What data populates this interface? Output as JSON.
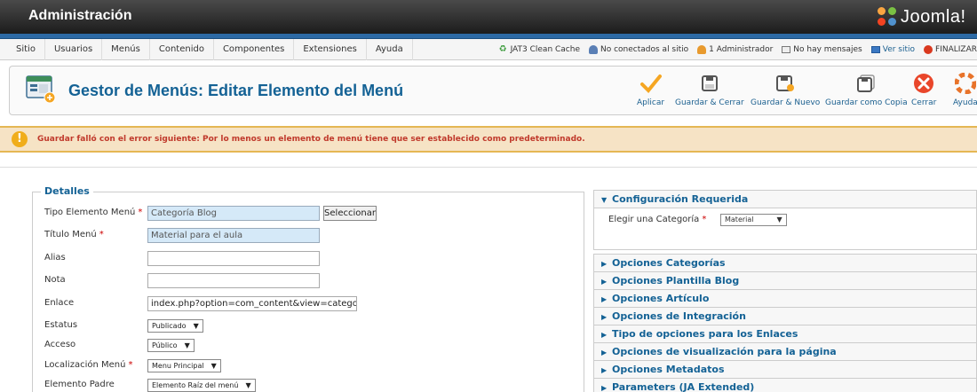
{
  "header": {
    "title": "Administración",
    "logo_text": "Joomla!"
  },
  "menubar": {
    "items": [
      "Sitio",
      "Usuarios",
      "Menús",
      "Contenido",
      "Componentes",
      "Extensiones",
      "Ayuda"
    ],
    "status": [
      "JAT3 Clean Cache",
      "No conectados al sitio",
      "1 Administrador",
      "No hay mensajes",
      "Ver sitio",
      "FINALIZAR"
    ]
  },
  "toolbar": {
    "title": "Gestor de Menús: Editar Elemento del Menú",
    "buttons": [
      "Aplicar",
      "Guardar & Cerrar",
      "Guardar & Nuevo",
      "Guardar como Copia",
      "Cerrar",
      "Ayuda"
    ]
  },
  "error": {
    "message": "Guardar falló con el error siguiente: Por lo menos un elemento de menú tiene que ser establecido como predeterminado."
  },
  "details": {
    "legend": "Detalles",
    "select_button": "Seleccionar",
    "fields": [
      {
        "label": "Tipo Elemento Menú",
        "required": "*",
        "value": "Categoría Blog"
      },
      {
        "label": "Título Menú",
        "required": "*",
        "value": "Material para el aula"
      },
      {
        "label": "Alias",
        "value": ""
      },
      {
        "label": "Nota",
        "value": ""
      },
      {
        "label": "Enlace",
        "value": "index.php?option=com_content&view=category&layout=blog"
      },
      {
        "label": "Estatus",
        "value": "Publicado"
      },
      {
        "label": "Acceso",
        "value": "Público"
      },
      {
        "label": "Localización Menú",
        "required": "*",
        "value": "Menu Principal"
      },
      {
        "label": "Elemento Padre",
        "value": "Elemento Raíz del menú"
      }
    ]
  },
  "panel": {
    "required_title": "Configuración Requerida",
    "category_label": "Elegir una Categoría",
    "category_required": "*",
    "category_value": "Material",
    "sections": [
      "Opciones Categorías",
      "Opciones Plantilla Blog",
      "Opciones Artículo",
      "Opciones de Integración",
      "Tipo de opciones para los Enlaces",
      "Opciones de visualización para la página",
      "Opciones Metadatos",
      "Parameters (JA Extended)"
    ]
  },
  "colors": {
    "accent": "#146295",
    "error": "#c0392b",
    "header_blue": "#2d6aa5"
  }
}
